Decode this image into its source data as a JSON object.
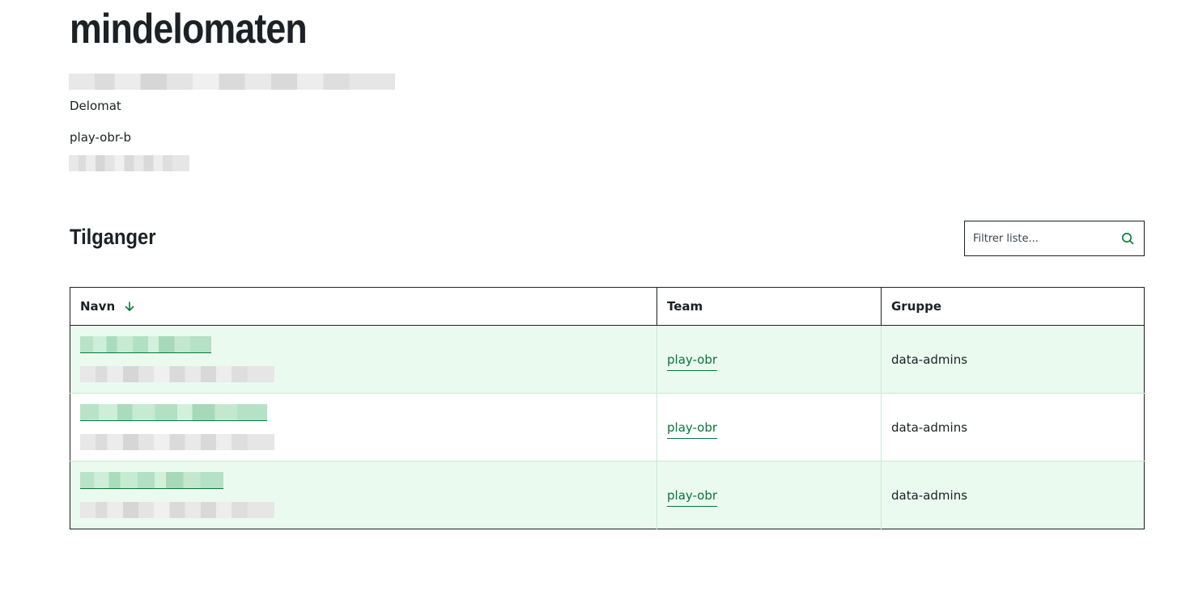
{
  "header": {
    "title": "mindelomaten",
    "type": "Delomat",
    "group": "play-obr-b"
  },
  "access": {
    "title": "Tilganger",
    "filter": {
      "placeholder": "Filtrer liste..."
    },
    "columns": {
      "name": "Navn",
      "team": "Team",
      "group": "Gruppe"
    },
    "rows": [
      {
        "team": "play-obr",
        "group": "data-admins"
      },
      {
        "team": "play-obr",
        "group": "data-admins"
      },
      {
        "team": "play-obr",
        "group": "data-admins"
      }
    ]
  },
  "colors": {
    "link": "#06773a",
    "row_highlight": "#ebfaee",
    "border": "#1b2125"
  },
  "icons": {
    "sort": "arrow-down-icon",
    "filter": "search-icon"
  }
}
